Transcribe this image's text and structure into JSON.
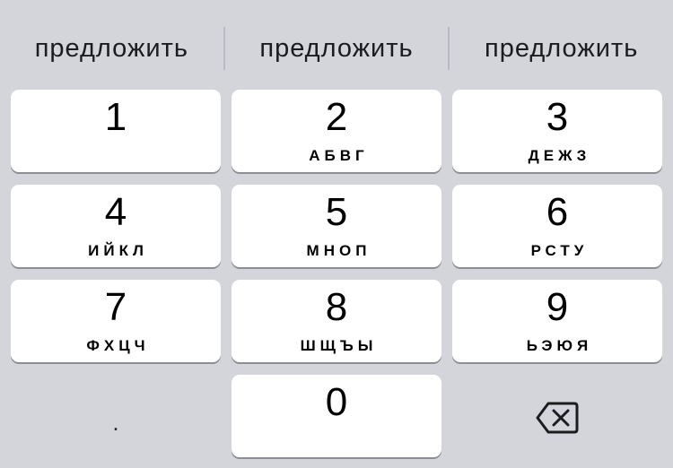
{
  "suggestions": [
    "предложить",
    "предложить",
    "предложить"
  ],
  "keys": [
    {
      "digit": "1",
      "letters": ""
    },
    {
      "digit": "2",
      "letters": "АБВГ"
    },
    {
      "digit": "3",
      "letters": "ДЕЖЗ"
    },
    {
      "digit": "4",
      "letters": "ИЙКЛ"
    },
    {
      "digit": "5",
      "letters": "МНОП"
    },
    {
      "digit": "6",
      "letters": "РСТУ"
    },
    {
      "digit": "7",
      "letters": "ФХЦЧ"
    },
    {
      "digit": "8",
      "letters": "ШЩЪЫ"
    },
    {
      "digit": "9",
      "letters": "ЬЭЮЯ"
    },
    {
      "digit": "0",
      "letters": ""
    }
  ],
  "decimal_key": {
    "label": "."
  },
  "delete_key": {
    "icon": "backspace-icon"
  },
  "colors": {
    "keyboard_background": "#d3d5db",
    "key_background": "#ffffff",
    "key_shadow": "#8c8e93"
  }
}
